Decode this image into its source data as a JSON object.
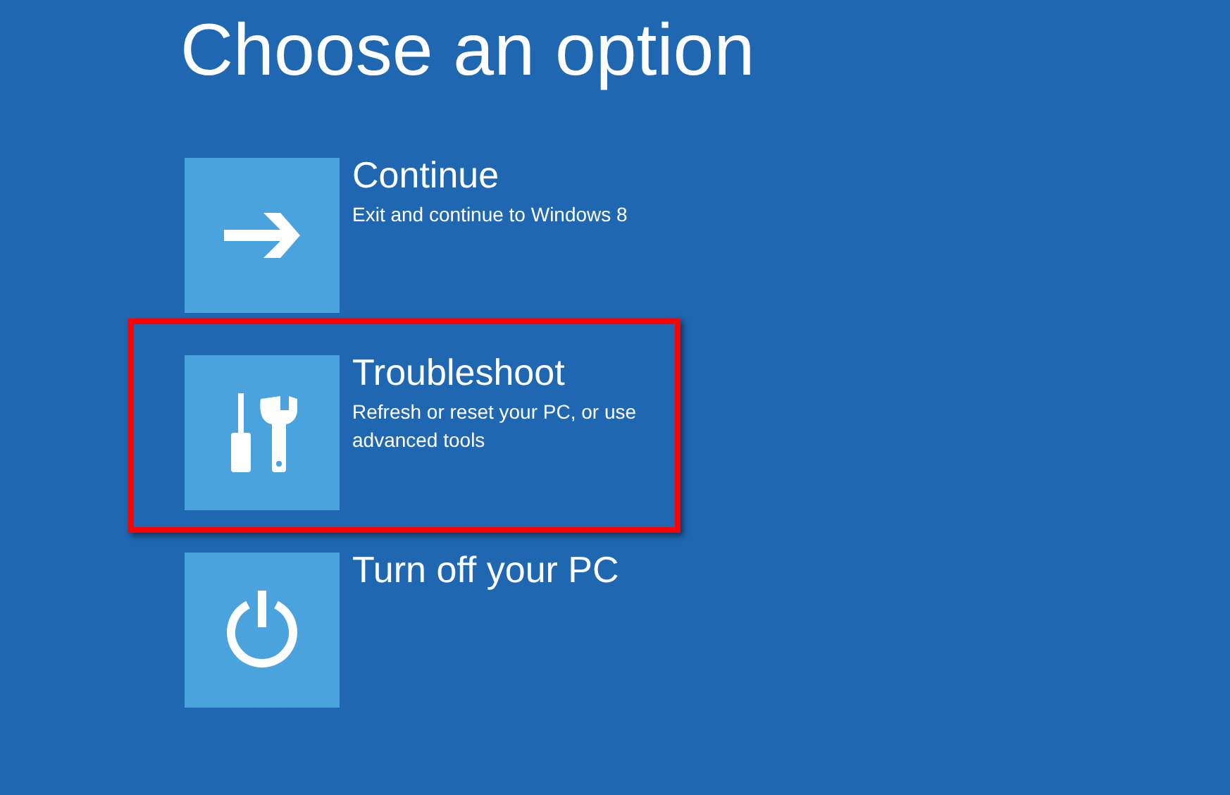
{
  "heading": "Choose an option",
  "options": [
    {
      "kind": "arrow",
      "title": "Continue",
      "description": "Exit and continue to Windows 8",
      "highlighted": false
    },
    {
      "kind": "tools",
      "title": "Troubleshoot",
      "description": "Refresh or reset your PC, or use advanced tools",
      "highlighted": true
    },
    {
      "kind": "power",
      "title": "Turn off your PC",
      "highlighted": false
    }
  ]
}
